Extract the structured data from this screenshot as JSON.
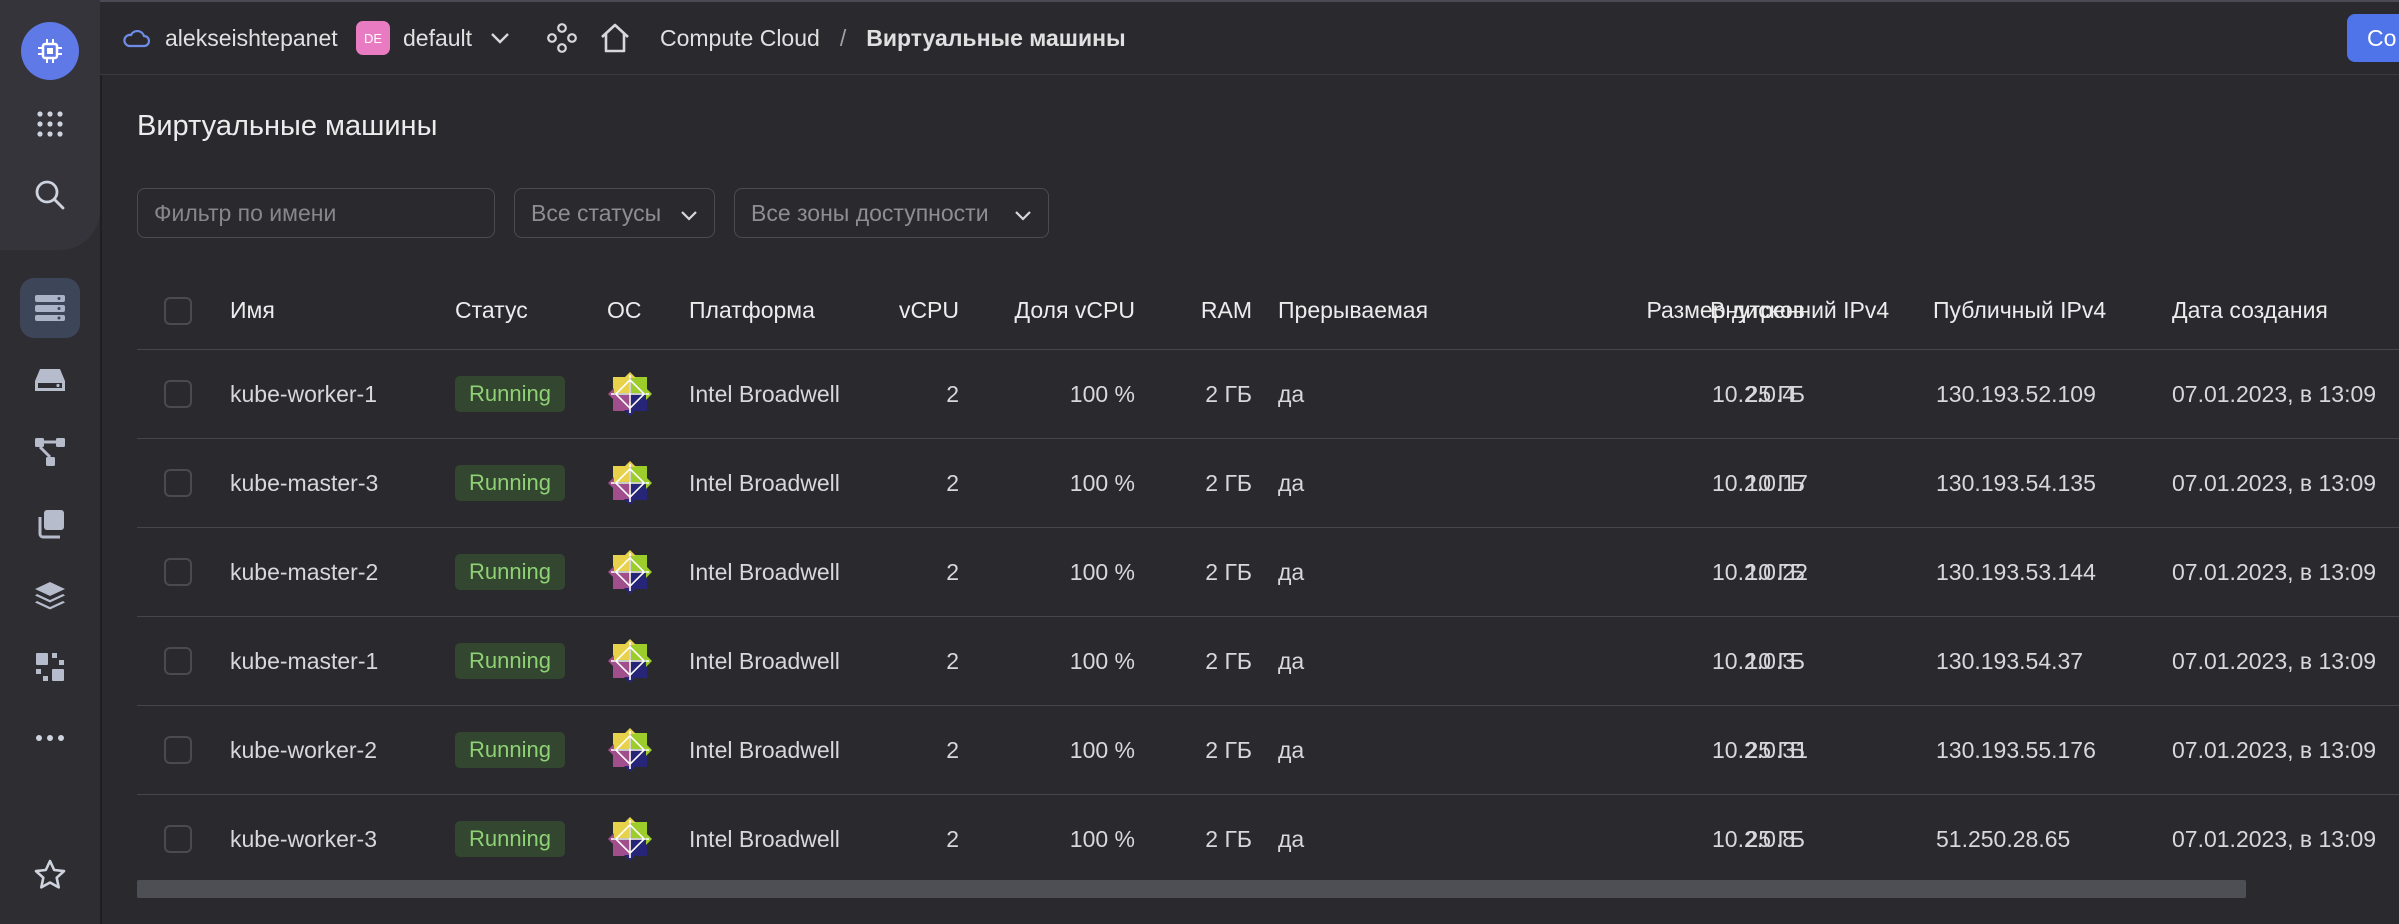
{
  "topbar": {
    "account": "alekseishtepanet",
    "folder_badge": "DE",
    "folder": "default",
    "breadcrumb_service": "Compute Cloud",
    "breadcrumb_separator": "/",
    "breadcrumb_current": "Виртуальные машины",
    "create_button": "Co"
  },
  "page": {
    "title": "Виртуальные машины"
  },
  "filters": {
    "name_placeholder": "Фильтр по имени",
    "status_value": "Все статусы",
    "zone_value": "Все зоны доступности"
  },
  "table": {
    "columns": {
      "name": "Имя",
      "status": "Статус",
      "os": "ОС",
      "platform": "Платформа",
      "vcpu": "vCPU",
      "vcpu_share": "Доля vCPU",
      "ram": "RAM",
      "preemptible": "Прерываемая",
      "disk_size": "Размер дисков",
      "internal_ip": "Внутренний IPv4",
      "public_ip": "Публичный IPv4",
      "created": "Дата создания"
    },
    "rows": [
      {
        "name": "kube-worker-1",
        "status": "Running",
        "platform": "Intel Broadwell",
        "vcpu": "2",
        "vcpu_share": "100 %",
        "ram": "2 ГБ",
        "preemptible": "да",
        "disk_size": "25 ГБ",
        "internal_ip": "10.2.0.4",
        "public_ip": "130.193.52.109",
        "created": "07.01.2023, в 13:09"
      },
      {
        "name": "kube-master-3",
        "status": "Running",
        "platform": "Intel Broadwell",
        "vcpu": "2",
        "vcpu_share": "100 %",
        "ram": "2 ГБ",
        "preemptible": "да",
        "disk_size": "10 ГБ",
        "internal_ip": "10.2.0.17",
        "public_ip": "130.193.54.135",
        "created": "07.01.2023, в 13:09"
      },
      {
        "name": "kube-master-2",
        "status": "Running",
        "platform": "Intel Broadwell",
        "vcpu": "2",
        "vcpu_share": "100 %",
        "ram": "2 ГБ",
        "preemptible": "да",
        "disk_size": "10 ГБ",
        "internal_ip": "10.2.0.22",
        "public_ip": "130.193.53.144",
        "created": "07.01.2023, в 13:09"
      },
      {
        "name": "kube-master-1",
        "status": "Running",
        "platform": "Intel Broadwell",
        "vcpu": "2",
        "vcpu_share": "100 %",
        "ram": "2 ГБ",
        "preemptible": "да",
        "disk_size": "10 ГБ",
        "internal_ip": "10.2.0.3",
        "public_ip": "130.193.54.37",
        "created": "07.01.2023, в 13:09"
      },
      {
        "name": "kube-worker-2",
        "status": "Running",
        "platform": "Intel Broadwell",
        "vcpu": "2",
        "vcpu_share": "100 %",
        "ram": "2 ГБ",
        "preemptible": "да",
        "disk_size": "25 ГБ",
        "internal_ip": "10.2.0.31",
        "public_ip": "130.193.55.176",
        "created": "07.01.2023, в 13:09"
      },
      {
        "name": "kube-worker-3",
        "status": "Running",
        "platform": "Intel Broadwell",
        "vcpu": "2",
        "vcpu_share": "100 %",
        "ram": "2 ГБ",
        "preemptible": "да",
        "disk_size": "25 ГБ",
        "internal_ip": "10.2.0.8",
        "public_ip": "51.250.28.65",
        "created": "07.01.2023, в 13:09"
      }
    ]
  },
  "colors": {
    "accent": "#5f79e6",
    "status_running_bg": "#33462f",
    "status_running_text": "#8fd175",
    "background": "#2a2a2e"
  },
  "icons": {
    "sidebar": [
      "compute-logo-icon",
      "services-grid-icon",
      "search-icon",
      "server-list-icon",
      "disk-icon",
      "network-icon",
      "copy-icon",
      "layers-icon",
      "placement-icon",
      "more-icon",
      "star-icon"
    ],
    "os": "centos-logo-icon"
  }
}
